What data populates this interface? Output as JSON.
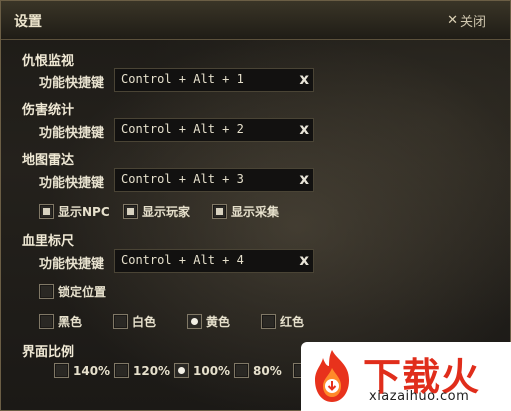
{
  "window": {
    "title": "设置",
    "close_label": "关闭"
  },
  "sections": {
    "hatred": {
      "title": "仇恨监视",
      "hotkey_label": "功能快捷键",
      "hotkey": "Control + Alt + 1"
    },
    "damage": {
      "title": "伤害统计",
      "hotkey_label": "功能快捷键",
      "hotkey": "Control + Alt + 2"
    },
    "radar": {
      "title": "地图雷达",
      "hotkey_label": "功能快捷键",
      "hotkey": "Control + Alt + 3",
      "options": [
        {
          "label": "显示NPC",
          "checked": true
        },
        {
          "label": "显示玩家",
          "checked": true
        },
        {
          "label": "显示采集",
          "checked": true
        }
      ]
    },
    "hpbar": {
      "title": "血里标尺",
      "hotkey_label": "功能快捷键",
      "hotkey": "Control + Alt + 4",
      "lock_label": "锁定位置",
      "colors": [
        {
          "label": "黑色",
          "selected": false
        },
        {
          "label": "白色",
          "selected": false
        },
        {
          "label": "黄色",
          "selected": true
        },
        {
          "label": "红色",
          "selected": false
        }
      ]
    },
    "scale": {
      "title": "界面比例",
      "options": [
        {
          "label": "140%",
          "selected": false
        },
        {
          "label": "120%",
          "selected": false
        },
        {
          "label": "100%",
          "selected": true
        },
        {
          "label": "80%",
          "selected": false
        }
      ]
    }
  },
  "watermark": {
    "title": "下载火",
    "url": "xiazaihuo.com"
  },
  "icons": {
    "clear": "close-x-icon",
    "window_close": "close-x-icon"
  }
}
